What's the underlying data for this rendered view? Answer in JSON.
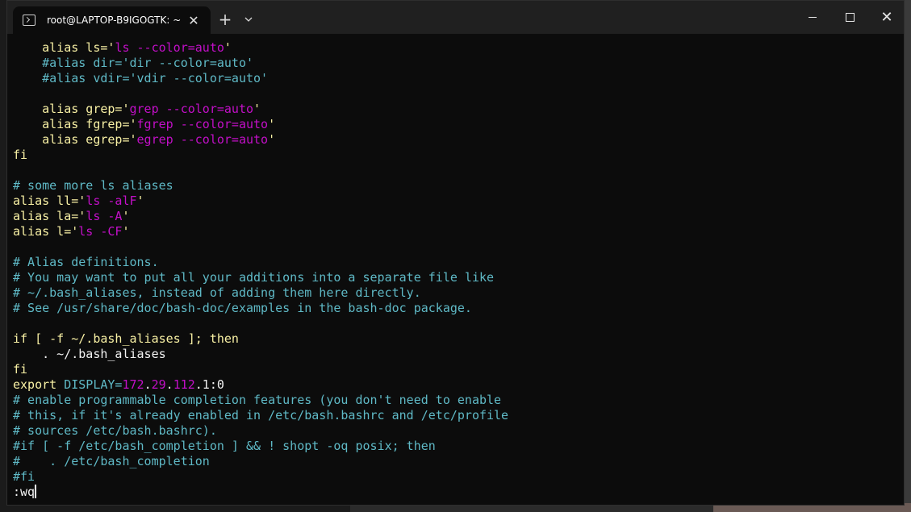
{
  "window": {
    "tab_title": "root@LAPTOP-B9IGOGTK: ~",
    "tab_close": "✕",
    "new_tab": "+",
    "dropdown": "⌄",
    "minimize": "",
    "maximize": "",
    "close": "✕"
  },
  "terminal": {
    "lines": [
      [
        {
          "t": "    alias ls='",
          "c": "y"
        },
        {
          "t": "ls --color=auto",
          "c": "m"
        },
        {
          "t": "'",
          "c": "y"
        }
      ],
      [
        {
          "t": "    #alias dir='dir --color=auto'",
          "c": "c"
        }
      ],
      [
        {
          "t": "    #alias vdir='vdir --color=auto'",
          "c": "c"
        }
      ],
      [
        {
          "t": "",
          "c": "w"
        }
      ],
      [
        {
          "t": "    alias grep='",
          "c": "y"
        },
        {
          "t": "grep --color=auto",
          "c": "m"
        },
        {
          "t": "'",
          "c": "y"
        }
      ],
      [
        {
          "t": "    alias fgrep='",
          "c": "y"
        },
        {
          "t": "fgrep --color=auto",
          "c": "m"
        },
        {
          "t": "'",
          "c": "y"
        }
      ],
      [
        {
          "t": "    alias egrep='",
          "c": "y"
        },
        {
          "t": "egrep --color=auto",
          "c": "m"
        },
        {
          "t": "'",
          "c": "y"
        }
      ],
      [
        {
          "t": "fi",
          "c": "y"
        }
      ],
      [
        {
          "t": "",
          "c": "w"
        }
      ],
      [
        {
          "t": "# some more ls aliases",
          "c": "c"
        }
      ],
      [
        {
          "t": "alias ll='",
          "c": "y"
        },
        {
          "t": "ls -alF",
          "c": "m"
        },
        {
          "t": "'",
          "c": "y"
        }
      ],
      [
        {
          "t": "alias la='",
          "c": "y"
        },
        {
          "t": "ls -A",
          "c": "m"
        },
        {
          "t": "'",
          "c": "y"
        }
      ],
      [
        {
          "t": "alias l='",
          "c": "y"
        },
        {
          "t": "ls -CF",
          "c": "m"
        },
        {
          "t": "'",
          "c": "y"
        }
      ],
      [
        {
          "t": "",
          "c": "w"
        }
      ],
      [
        {
          "t": "# Alias definitions.",
          "c": "c"
        }
      ],
      [
        {
          "t": "# You may want to put all your additions into a separate file like",
          "c": "c"
        }
      ],
      [
        {
          "t": "# ~/.bash_aliases, instead of adding them here directly.",
          "c": "c"
        }
      ],
      [
        {
          "t": "# See /usr/share/doc/bash-doc/examples in the bash-doc package.",
          "c": "c"
        }
      ],
      [
        {
          "t": "",
          "c": "w"
        }
      ],
      [
        {
          "t": "if [ -f ~/.bash_aliases ]; then",
          "c": "y"
        }
      ],
      [
        {
          "t": "    . ~/.bash_aliases",
          "c": "w"
        }
      ],
      [
        {
          "t": "fi",
          "c": "y"
        }
      ],
      [
        {
          "t": "export ",
          "c": "y"
        },
        {
          "t": "DISPLAY=",
          "c": "c"
        },
        {
          "t": "172",
          "c": "m"
        },
        {
          "t": ".",
          "c": "w"
        },
        {
          "t": "29",
          "c": "m"
        },
        {
          "t": ".",
          "c": "w"
        },
        {
          "t": "112",
          "c": "m"
        },
        {
          "t": ".1:0",
          "c": "w"
        }
      ],
      [
        {
          "t": "# enable programmable completion features (you don't need to enable",
          "c": "c"
        }
      ],
      [
        {
          "t": "# this, if it's already enabled in /etc/bash.bashrc and /etc/profile",
          "c": "c"
        }
      ],
      [
        {
          "t": "# sources /etc/bash.bashrc).",
          "c": "c"
        }
      ],
      [
        {
          "t": "#if [ -f /etc/bash_completion ] && ! shopt -oq posix; then",
          "c": "c"
        }
      ],
      [
        {
          "t": "#    . /etc/bash_completion",
          "c": "c"
        }
      ],
      [
        {
          "t": "#fi",
          "c": "c"
        }
      ],
      [
        {
          "t": ":wq",
          "c": "w"
        }
      ]
    ]
  },
  "colors": {
    "y": "#f9f1a5",
    "m": "#c30fc8",
    "c": "#5fb9c6",
    "w": "#f2f2f2"
  }
}
